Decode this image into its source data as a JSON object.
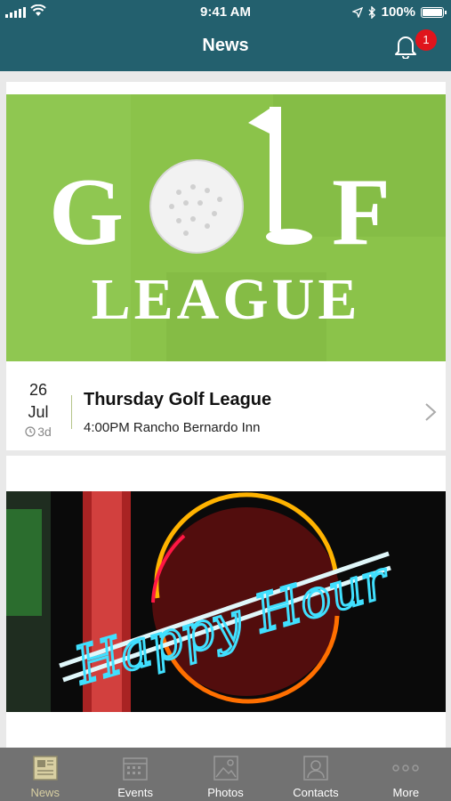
{
  "status_bar": {
    "time": "9:41 AM",
    "battery": "100%"
  },
  "header": {
    "title": "News",
    "notification_count": "1"
  },
  "feed": [
    {
      "image": {
        "kind": "golf-league-banner",
        "word1": "G",
        "word2": "F",
        "word3": "LEAGUE"
      },
      "day": "26",
      "month": "Jul",
      "relative": "3d",
      "title": "Thursday Golf League",
      "subtitle": "4:00PM Rancho Bernardo Inn"
    },
    {
      "image": {
        "kind": "happy-hour-neon-sign",
        "text": "Happy Hour"
      }
    }
  ],
  "tabs": [
    {
      "label": "News",
      "icon": "newspaper-icon",
      "active": true
    },
    {
      "label": "Events",
      "icon": "calendar-icon",
      "active": false
    },
    {
      "label": "Photos",
      "icon": "photo-icon",
      "active": false
    },
    {
      "label": "Contacts",
      "icon": "contact-card-icon",
      "active": false
    },
    {
      "label": "More",
      "icon": "more-dots-icon",
      "active": false
    }
  ],
  "colors": {
    "header": "#23606e",
    "tabbar": "#727272",
    "active_tab": "#d8cfa2",
    "badge": "#e0141c",
    "golf_green": "#8bc34a"
  }
}
